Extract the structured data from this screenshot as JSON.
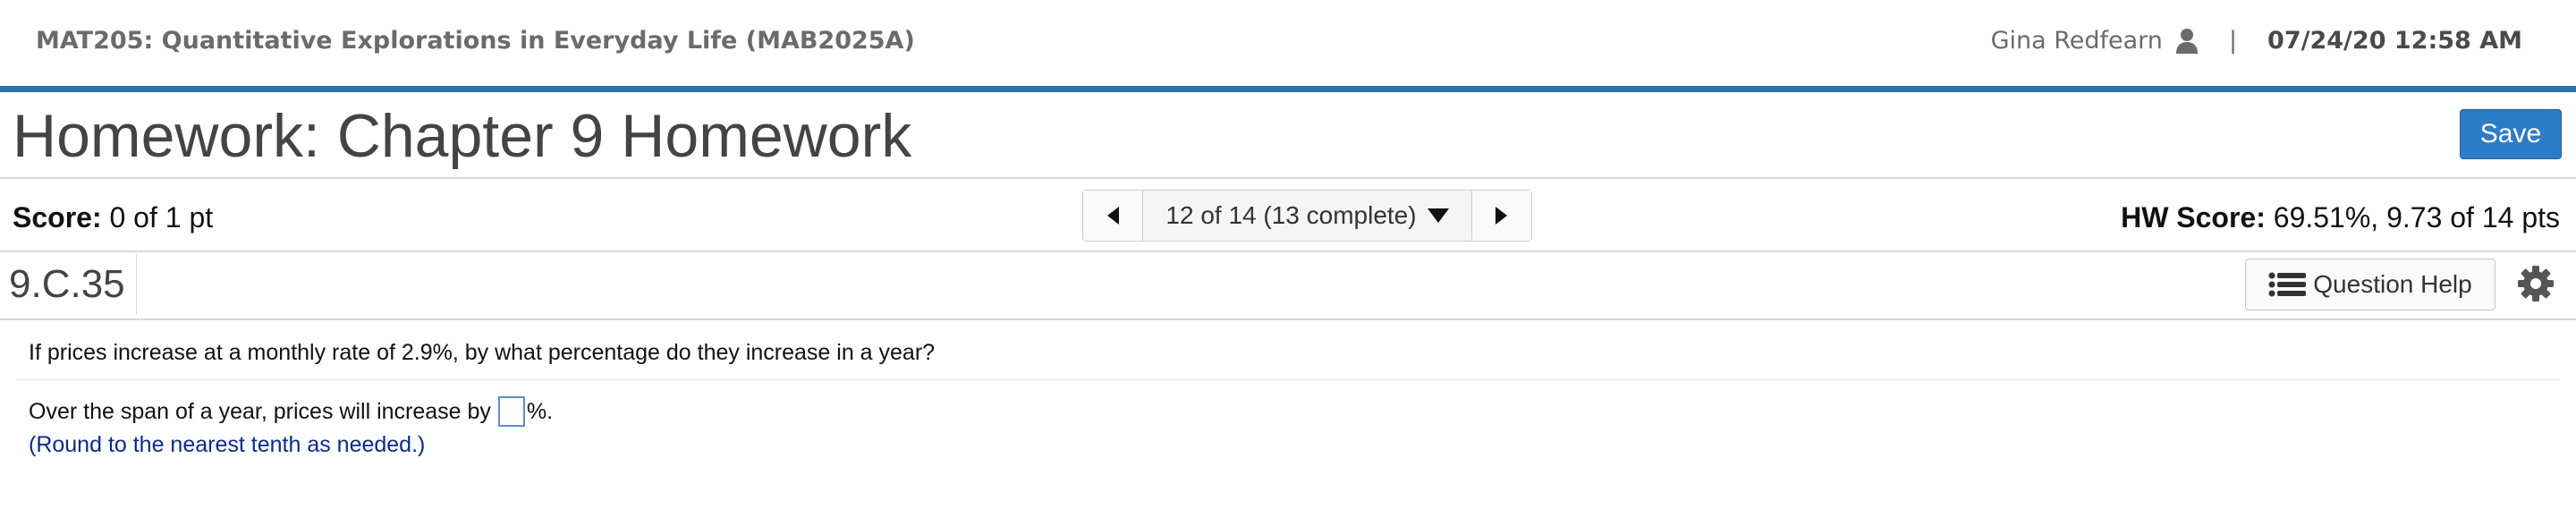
{
  "header": {
    "course": "MAT205: Quantitative Explorations in Everyday Life (MAB2025A)",
    "user_name": "Gina Redfearn",
    "separator": "|",
    "datetime": "07/24/20 12:58 AM"
  },
  "title_bar": {
    "title": "Homework: Chapter 9 Homework",
    "save_label": "Save"
  },
  "score_bar": {
    "score_label": "Score:",
    "score_value": "0 of 1 pt",
    "nav_text": "12 of 14 (13 complete)",
    "hw_score_label": "HW Score:",
    "hw_score_value": "69.51%, 9.73 of 14 pts"
  },
  "question_bar": {
    "question_id": "9.C.35",
    "help_label": "Question Help"
  },
  "question": {
    "prompt": "If prices increase at a monthly rate of 2.9%, by what percentage do they increase in a year?",
    "answer_prefix": "Over the span of a year, prices will increase by",
    "answer_value": "",
    "answer_suffix": "%.",
    "hint": "(Round to the nearest tenth as needed.)"
  },
  "colors": {
    "accent": "#2c72ad",
    "save_button": "#2d7cc7",
    "hint_text": "#0b2b8a"
  },
  "icons": [
    "user-icon",
    "prev-arrow-icon",
    "dropdown-caret-icon",
    "next-arrow-icon",
    "list-icon",
    "gear-icon"
  ]
}
